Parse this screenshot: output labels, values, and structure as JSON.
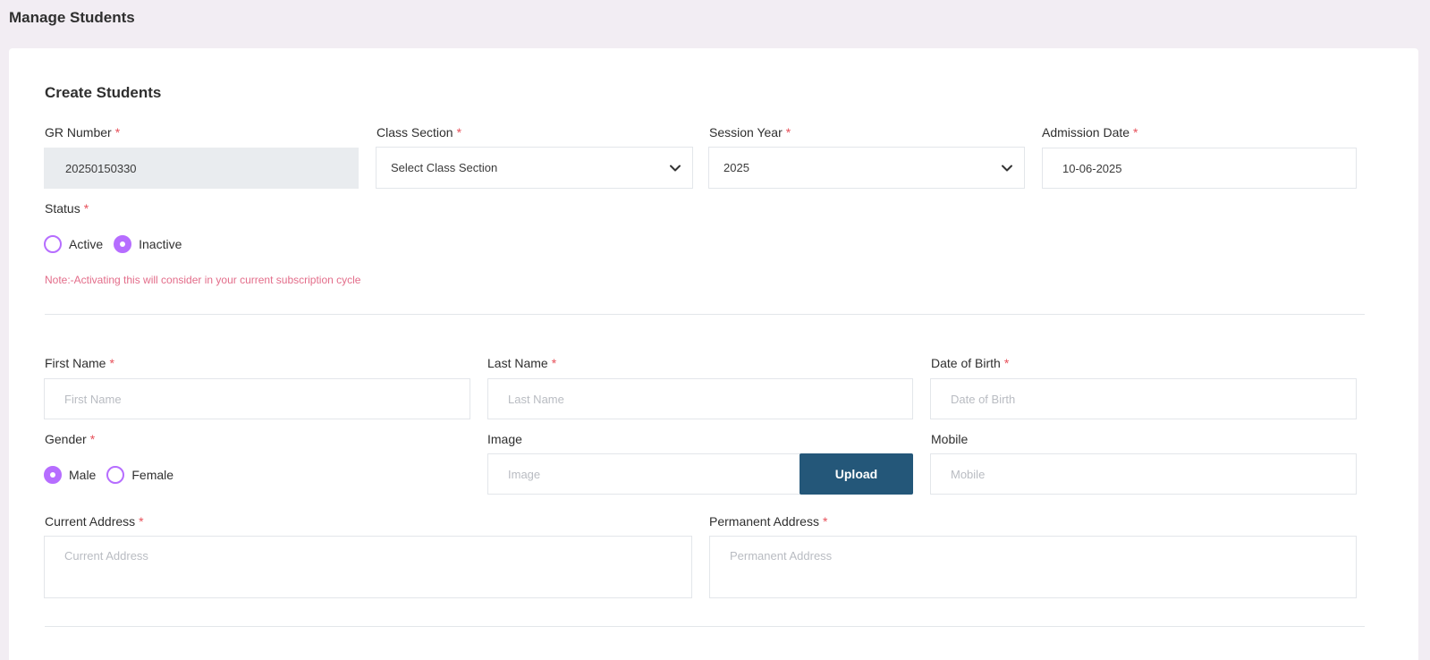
{
  "page": {
    "title": "Manage Students"
  },
  "form": {
    "title": "Create Students",
    "required_mark": "*",
    "gr_number": {
      "label": "GR Number",
      "value": "20250150330"
    },
    "class_section": {
      "label": "Class Section",
      "value": "Select Class Section"
    },
    "session_year": {
      "label": "Session Year",
      "value": "2025"
    },
    "admission_date": {
      "label": "Admission Date",
      "value": "10-06-2025"
    },
    "status": {
      "label": "Status",
      "options": [
        {
          "label": "Active",
          "checked": false
        },
        {
          "label": "Inactive",
          "checked": true
        }
      ],
      "note": "Note:-Activating this will consider in your current subscription cycle"
    },
    "first_name": {
      "label": "First Name",
      "placeholder": "First Name"
    },
    "last_name": {
      "label": "Last Name",
      "placeholder": "Last Name"
    },
    "dob": {
      "label": "Date of Birth",
      "placeholder": "Date of Birth"
    },
    "gender": {
      "label": "Gender",
      "options": [
        {
          "label": "Male",
          "checked": true
        },
        {
          "label": "Female",
          "checked": false
        }
      ]
    },
    "image": {
      "label": "Image",
      "placeholder": "Image",
      "upload_label": "Upload"
    },
    "mobile": {
      "label": "Mobile",
      "placeholder": "Mobile"
    },
    "current_address": {
      "label": "Current Address",
      "placeholder": "Current Address"
    },
    "permanent_address": {
      "label": "Permanent Address",
      "placeholder": "Permanent Address"
    }
  },
  "colors": {
    "accent": "#b66dff",
    "required": "#e7505a",
    "note": "#e36d8a",
    "upload_button": "#245779"
  },
  "icons": {
    "select_arrow": "chevron-down-icon"
  }
}
